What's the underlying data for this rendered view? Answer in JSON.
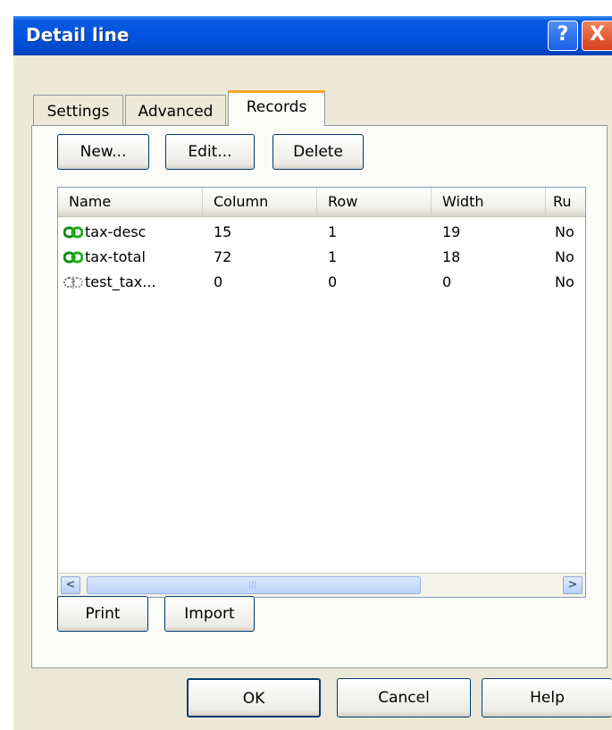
{
  "window": {
    "title": "Detail line"
  },
  "titlebar": {
    "help_glyph": "?",
    "close_glyph": "X"
  },
  "tabs": [
    {
      "label": "Settings",
      "active": false
    },
    {
      "label": "Advanced",
      "active": false
    },
    {
      "label": "Records",
      "active": true
    }
  ],
  "toolbar": {
    "new": {
      "mnemonic": "N",
      "rest": "ew..."
    },
    "edit": {
      "mnemonic": "E",
      "rest": "dit..."
    },
    "delete": {
      "mnemonic": "D",
      "rest": "elete"
    }
  },
  "table": {
    "columns": [
      "Name",
      "Column",
      "Row",
      "Width",
      "Ru"
    ],
    "rows": [
      {
        "icon": "linked-chain-icon",
        "name": "tax-desc",
        "column": "15",
        "row": "1",
        "width": "19",
        "rule": "No"
      },
      {
        "icon": "linked-chain-icon",
        "name": "tax-total",
        "column": "72",
        "row": "1",
        "width": "18",
        "rule": "No"
      },
      {
        "icon": "broken-chain-icon",
        "name": "test_tax...",
        "column": "0",
        "row": "0",
        "width": "0",
        "rule": "No"
      }
    ]
  },
  "scrollbar": {
    "left_glyph": "<",
    "right_glyph": ">",
    "grip_glyph": "|||"
  },
  "bottom_buttons": {
    "print": {
      "mnemonic": "P",
      "rest": "rint"
    },
    "import": {
      "mnemonic": "I",
      "rest": "mport"
    }
  },
  "footer": {
    "ok": "OK",
    "cancel": "Cancel",
    "help": "Help"
  },
  "colors": {
    "title_bar": "#0054e3",
    "dialog_bg": "#ece9d8",
    "link_green": "#16a016",
    "accent_tab": "#f5a623"
  }
}
